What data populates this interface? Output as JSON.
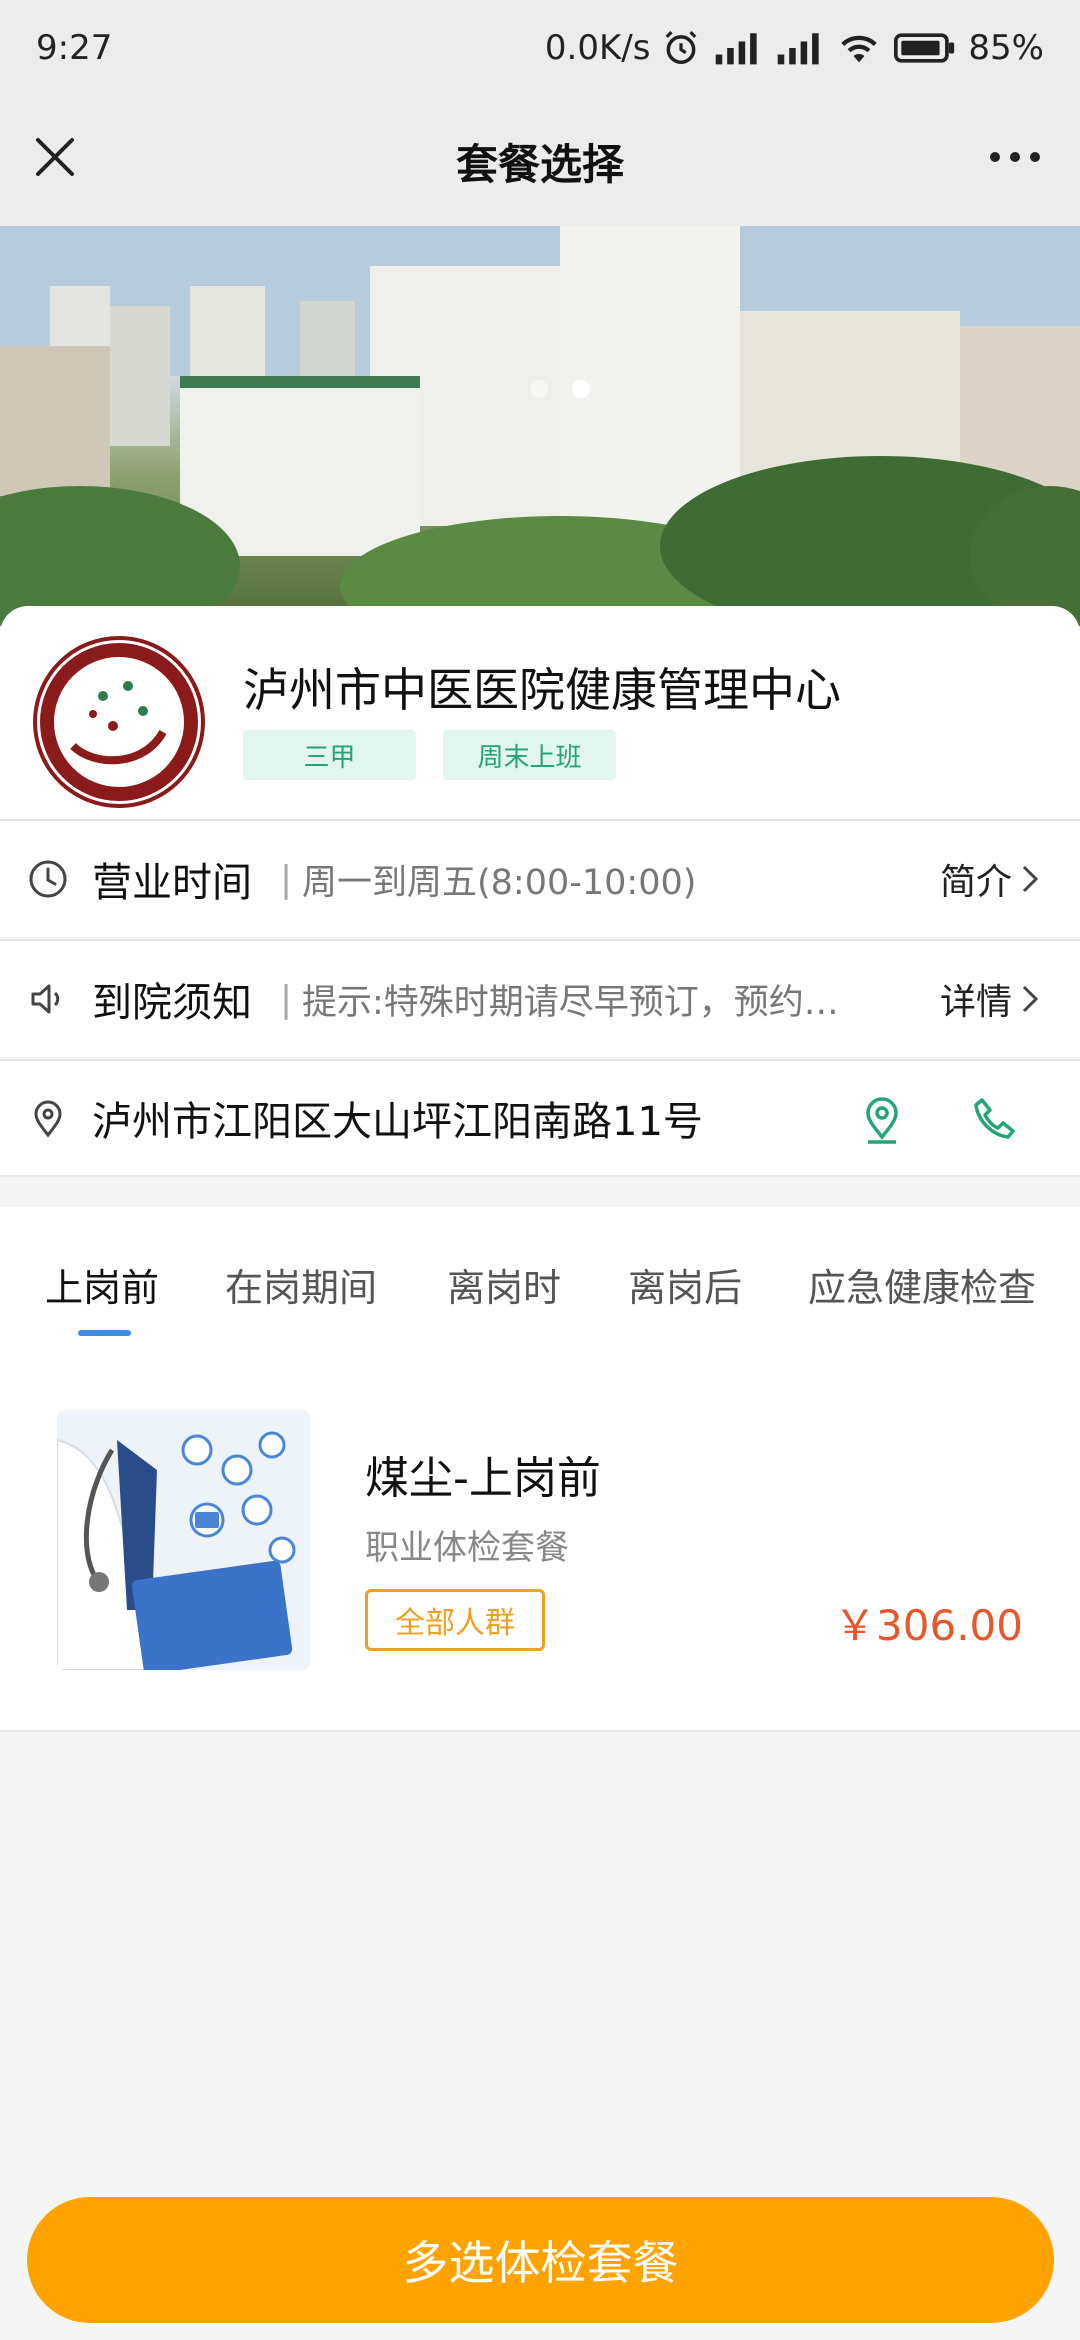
{
  "status_bar": {
    "time": "9:27",
    "net_speed": "0.0K/s",
    "battery": "85%"
  },
  "nav": {
    "title": "套餐选择"
  },
  "hospital": {
    "name": "泸州市中医医院健康管理中心",
    "tags": [
      "三甲",
      "周末上班"
    ],
    "hours_label": "营业时间",
    "hours_value": "周一到周五(8:00-10:00)",
    "intro_link": "简介",
    "notice_label": "到院须知",
    "notice_value": "提示:特殊时期请尽早预订，预约…",
    "notice_link": "详情",
    "address": "泸州市江阳区大山坪江阳南路11号"
  },
  "tabs": [
    "上岗前",
    "在岗期间",
    "离岗时",
    "离岗后",
    "应急健康检查"
  ],
  "active_tab": 0,
  "package": {
    "title": "煤尘-上岗前",
    "subtitle": "职业体检套餐",
    "badge": "全部人群",
    "price": "￥306.00"
  },
  "bottom_button": "多选体检套餐",
  "colors": {
    "accent_green": "#23a47a",
    "tab_underline": "#3a8de8",
    "price": "#e8562a",
    "button": "#ffa300"
  }
}
